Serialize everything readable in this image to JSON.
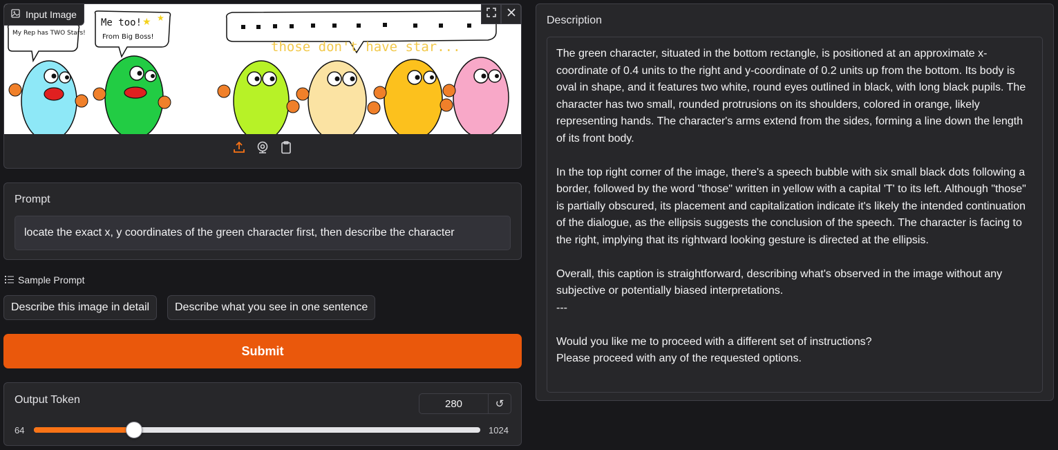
{
  "image_panel": {
    "label": "Input Image",
    "image_icon": "image-icon",
    "fullscreen_icon": "fullscreen-icon",
    "close_icon": "close-icon",
    "upload_icon": "upload-icon",
    "webcam_icon": "webcam-icon",
    "clipboard_icon": "clipboard-icon",
    "comic": {
      "bubble_left": "My Rep has TWO Stars!",
      "bubble_mid_1": "Me too!",
      "bubble_mid_2": "From Big Boss!",
      "caption": "those don't have star...",
      "character_colors": [
        "#8ee8f7",
        "#22cc44",
        "#b7f227",
        "#fbe3a3",
        "#fcc11d",
        "#f8a8c8"
      ]
    }
  },
  "prompt": {
    "title": "Prompt",
    "value": "locate the exact x, y coordinates of the green character first, then describe the character"
  },
  "samples": {
    "label": "Sample Prompt",
    "items": [
      "Describe this image in detail",
      "Describe what you see in one sentence"
    ]
  },
  "submit": {
    "label": "Submit"
  },
  "output_token": {
    "title": "Output Token",
    "value": "280",
    "min": "64",
    "max": "1024",
    "reset_icon": "reset-icon"
  },
  "description": {
    "title": "Description",
    "paragraphs": [
      "The green character, situated in the bottom rectangle, is positioned at an approximate x-coordinate of 0.4 units to the right and y-coordinate of 0.2 units up from the bottom. Its body is oval in shape, and it features two white, round eyes outlined in black, with long black pupils. The character has two small, rounded protrusions on its shoulders, colored in orange, likely representing hands. The character's arms extend from the sides, forming a line down the length of its front body.",
      "",
      "In the top right corner of the image, there's a speech bubble with six small black dots following a border, followed by the word \"those\" written in yellow with a capital 'T' to its left. Although \"those\" is partially obscured, its placement and capitalization indicate it's likely the intended continuation of the dialogue, as the ellipsis suggests the conclusion of the speech. The character is facing to the right, implying that its rightward looking gesture is directed at the ellipsis.",
      "",
      "Overall, this caption is straightforward, describing what's observed in the image without any subjective or potentially biased interpretations.",
      "---",
      "",
      "Would you like me to proceed with a different set of instructions?",
      "Please proceed with any of the requested options."
    ]
  },
  "colors": {
    "accent": "#ea580c",
    "panel": "#27272a",
    "border": "#3f3f46",
    "background": "#18181b"
  }
}
